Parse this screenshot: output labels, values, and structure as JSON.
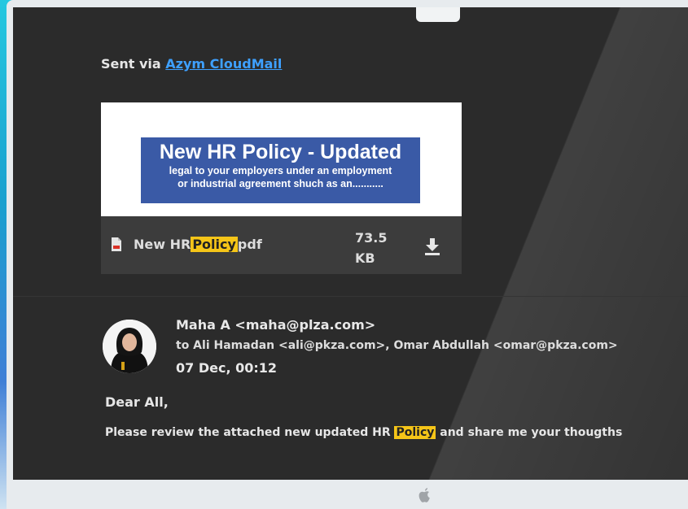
{
  "email": {
    "sent_via_prefix": "Sent via",
    "sent_via_link": "Azym CloudMail",
    "banner": {
      "title": "New HR Policy - Updated",
      "subtitle_line1": "legal to your employers under an employment",
      "subtitle_line2": "or industrial agreement shuch as an..........."
    },
    "attachment": {
      "icon": "pdf-file-icon",
      "name_before": "New HR",
      "name_highlight": "Policy",
      "name_after": "pdf",
      "size_value": "73.5",
      "size_unit": "KB",
      "download_icon": "download-icon"
    },
    "sender": {
      "from": "Maha A <maha@plza.com>",
      "to": "to Ali Hamadan <ali@pkza.com>, Omar Abdullah <omar@pkza.com>",
      "date": "07 Dec, 00:12"
    },
    "greeting": "Dear All,",
    "body_before": "Please review the attached new updated HR",
    "body_highlight": "Policy",
    "body_after": "and share me your thougths"
  },
  "colors": {
    "screen_bg": "#2b2b2b",
    "link": "#3ea0ff",
    "highlight": "#f5c518",
    "banner_blue": "#3a5aa6"
  },
  "device": {
    "logo_icon": "apple-logo-icon"
  }
}
